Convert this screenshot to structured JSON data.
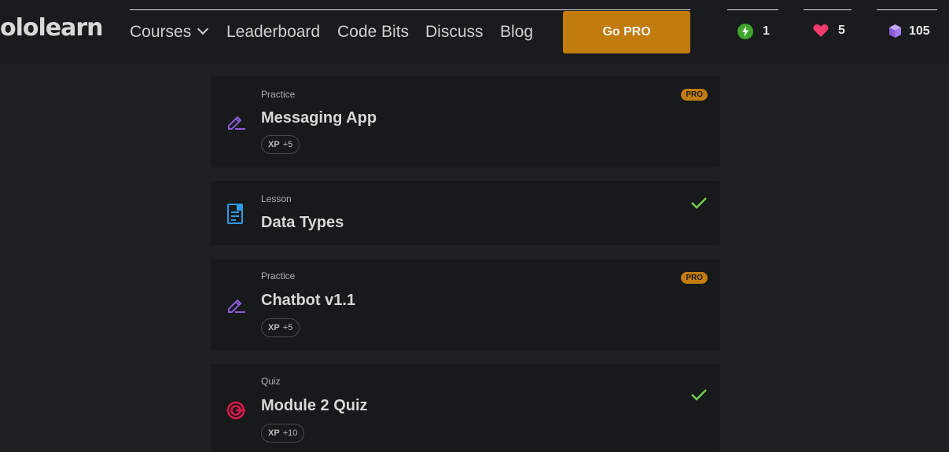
{
  "header": {
    "logo": "ololearn",
    "nav": [
      {
        "label": "Courses",
        "has_dropdown": true
      },
      {
        "label": "Leaderboard"
      },
      {
        "label": "Code Bits"
      },
      {
        "label": "Discuss"
      },
      {
        "label": "Blog"
      }
    ],
    "go_pro_label": "Go PRO",
    "stats": {
      "streak": "1",
      "hearts": "5",
      "bits": "105"
    }
  },
  "colors": {
    "accent": "#c27c0e",
    "check": "#6fd04a",
    "practice_icon": "#8a5bd8",
    "lesson_icon": "#2b9ae6",
    "quiz_icon": "#e0184b"
  },
  "cards": [
    {
      "kind": "Practice",
      "title": "Messaging App",
      "xp_label": "XP",
      "xp_value": "+5",
      "badge": "PRO",
      "icon": "pencil-icon"
    },
    {
      "kind": "Lesson",
      "title": "Data Types",
      "status": "completed",
      "icon": "document-icon"
    },
    {
      "kind": "Practice",
      "title": "Chatbot v1.1",
      "xp_label": "XP",
      "xp_value": "+5",
      "badge": "PRO",
      "icon": "pencil-icon"
    },
    {
      "kind": "Quiz",
      "title": "Module 2 Quiz",
      "xp_label": "XP",
      "xp_value": "+10",
      "status": "completed",
      "icon": "target-icon"
    }
  ]
}
